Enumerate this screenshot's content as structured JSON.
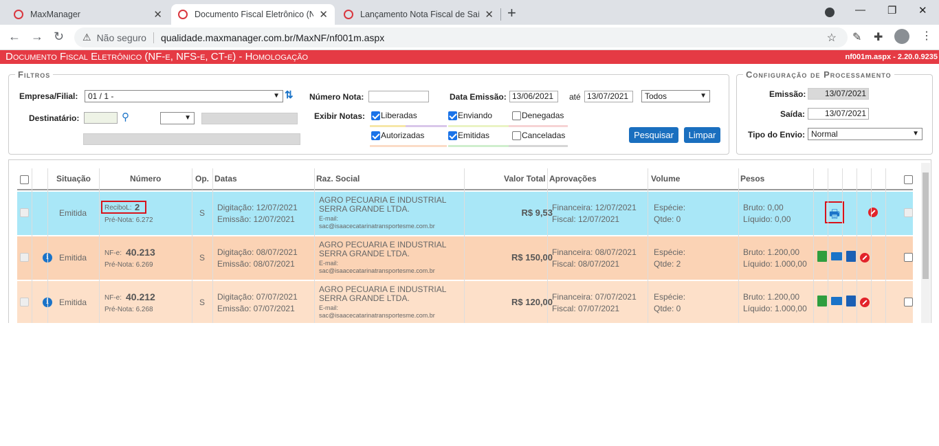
{
  "browser": {
    "tabs": [
      {
        "title": "MaxManager"
      },
      {
        "title": "Documento Fiscal Eletrônico (NF"
      },
      {
        "title": "Lançamento Nota Fiscal de Saída"
      }
    ],
    "security": "Não seguro",
    "url": "qualidade.maxmanager.com.br/MaxNF/nf001m.aspx"
  },
  "banner": {
    "title": "Documento Fiscal Eletrônico (NF-e, NFS-e, CT-e)  - Homologação",
    "version": "nf001m.aspx - 2.20.0.9235"
  },
  "filtros": {
    "legend": "Filtros",
    "empresa_label": "Empresa/Filial:",
    "empresa_value": "01 / 1 -",
    "destinatario_label": "Destinatário:",
    "numero_label": "Número Nota:",
    "numero_value": "",
    "data_label": "Data Emissão:",
    "data_from": "13/06/2021",
    "ate": "até",
    "data_to": "13/07/2021",
    "todos": "Todos",
    "exibir_label": "Exibir Notas:",
    "liberadas": "Liberadas",
    "enviando": "Enviando",
    "denegadas": "Denegadas",
    "autorizadas": "Autorizadas",
    "emitidas": "Emitidas",
    "canceladas": "Canceladas",
    "pesquisar": "Pesquisar",
    "limpar": "Limpar"
  },
  "config": {
    "legend": "Configuração de Processamento",
    "emissao_label": "Emissão:",
    "emissao_value": "13/07/2021",
    "saida_label": "Saída:",
    "saida_value": "13/07/2021",
    "tipo_label": "Tipo do Envio:",
    "tipo_value": "Normal"
  },
  "grid": {
    "headers": {
      "situacao": "Situação",
      "numero": "Número",
      "op": "Op.",
      "datas": "Datas",
      "razao": "Raz. Social",
      "valor": "Valor Total",
      "aprovacoes": "Aprovações",
      "volume": "Volume",
      "pesos": "Pesos"
    },
    "rows": [
      {
        "situacao": "Emitida",
        "num_prefix": "ReciboL:",
        "num_value": "2",
        "prenota": "Pré-Nota:  6.272",
        "op": "S",
        "digitacao": "Digitação:  12/07/2021",
        "emissao": "Emissão:  12/07/2021",
        "razao1": "AGRO PECUARIA E INDUSTRIAL",
        "razao2": "SERRA GRANDE LTDA.",
        "email_label": "E-mail:",
        "email": "sac@isaacecatarinatransportesme.com.br",
        "valor": "R$ 9,53",
        "financeira": "Financeira:  12/07/2021",
        "fiscal": "Fiscal:  12/07/2021",
        "especie": "Espécie:",
        "qtde": "Qtde:  0",
        "bruto": "Bruto:  0,00",
        "liquido": "Líquido:  0,00"
      },
      {
        "situacao": "Emitida",
        "num_prefix": "NF-e:",
        "num_value": "40.213",
        "prenota": "Pré-Nota:  6.269",
        "op": "S",
        "digitacao": "Digitação:  08/07/2021",
        "emissao": "Emissão:  08/07/2021",
        "razao1": "AGRO PECUARIA E INDUSTRIAL",
        "razao2": "SERRA GRANDE LTDA.",
        "email_label": "E-mail:",
        "email": "sac@isaacecatarinatransportesme.com.br",
        "valor": "R$ 150,00",
        "financeira": "Financeira:  08/07/2021",
        "fiscal": "Fiscal:  08/07/2021",
        "especie": "Espécie:",
        "qtde": "Qtde:  2",
        "bruto": "Bruto:  1.200,00",
        "liquido": "Líquido:  1.000,00"
      },
      {
        "situacao": "Emitida",
        "num_prefix": "NF-e:",
        "num_value": "40.212",
        "prenota": "Pré-Nota:  6.268",
        "op": "S",
        "digitacao": "Digitação:  07/07/2021",
        "emissao": "Emissão:  07/07/2021",
        "razao1": "AGRO PECUARIA E INDUSTRIAL",
        "razao2": "SERRA GRANDE LTDA.",
        "email_label": "E-mail:",
        "email": "sac@isaacecatarinatransportesme.com.br",
        "valor": "R$ 120,00",
        "financeira": "Financeira:  07/07/2021",
        "fiscal": "Fiscal:  07/07/2021",
        "especie": "Espécie:",
        "qtde": "Qtde:  0",
        "bruto": "Bruto:  1.200,00",
        "liquido": "Líquido:  1.000,00"
      }
    ],
    "row_colors": [
      "#a9e7f7",
      "#fbd3b5",
      "#fde0c9"
    ]
  },
  "icons": {
    "info": "i"
  }
}
